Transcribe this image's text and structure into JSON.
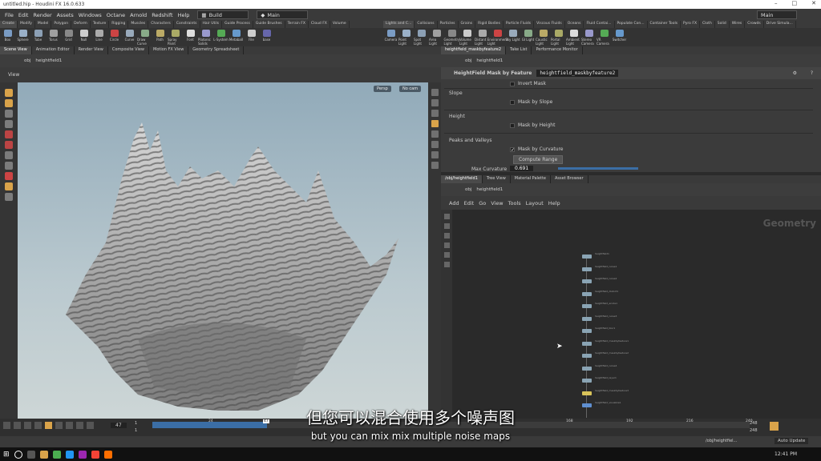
{
  "window": {
    "title": "untitled.hip - Houdini FX 16.0.633"
  },
  "menu": {
    "items": [
      "File",
      "Edit",
      "Render",
      "Assets",
      "Windows",
      "Octane",
      "Arnold",
      "Redshift",
      "Help"
    ],
    "desktop": "Build",
    "context": "Main",
    "right_desktop": "Main"
  },
  "shelf_left_tabs": [
    "Create",
    "Modify",
    "Model",
    "Polygon",
    "Deform",
    "Texture",
    "Rigging",
    "Muscles",
    "Characters",
    "Constraints",
    "Hair Utils",
    "Guide Process",
    "Guide Brushes",
    "Terrain FX",
    "Cloud FX",
    "Volume"
  ],
  "shelf_left_tools": [
    "Box",
    "Sphere",
    "Tube",
    "Torus",
    "Grid",
    "Null",
    "Line",
    "Circle",
    "Curve",
    "Draw Curve",
    "Path",
    "Spray Paint",
    "Font",
    "Platonic Solids",
    "L-System",
    "Metaball",
    "File",
    "base"
  ],
  "shelf_right_tabs": [
    "Lights and C...",
    "Collisions",
    "Particles",
    "Grains",
    "Rigid Bodies",
    "Particle Fluids",
    "Viscous Fluids",
    "Oceans",
    "Fluid Contai...",
    "Populate Con...",
    "Container Tools",
    "Pyro FX",
    "Cloth",
    "Solid",
    "Wires",
    "Crowds",
    "Drive Simula..."
  ],
  "shelf_right_tools": [
    "Camera",
    "Point Light",
    "Spot Light",
    "Area Light",
    "Geometry Light",
    "Volume Light",
    "Distant Light",
    "Environment Light",
    "Sky Light",
    "GI Light",
    "Caustic Light",
    "Portal Light",
    "Ambient Light",
    "Stereo Camera",
    "VR Camera",
    "Switcher"
  ],
  "left_pane": {
    "tabs": [
      "Scene View",
      "Animation Editor",
      "Render View",
      "Composite View",
      "Motion FX View",
      "Geometry Spreadsheet"
    ],
    "path": [
      "obj",
      "heightfield1"
    ],
    "viewport_title": "View",
    "persp_btn": "Persp",
    "cam_btn": "No cam"
  },
  "right_top_pane": {
    "tabs": [
      "heightfield_maskbyfeature2",
      "Take List",
      "Performance Monitor"
    ],
    "path": [
      "obj",
      "heightfield1"
    ],
    "node_type": "HeightField Mask by Feature",
    "node_name": "heightfield_maskbyfeature2",
    "params": {
      "invert_mask": "Invert Mask",
      "slope_section": "Slope",
      "mask_by_slope": "Mask by Slope",
      "height_section": "Height",
      "mask_by_height": "Mask by Height",
      "peaks_section": "Peaks and Valleys",
      "mask_by_curvature": "Mask by Curvature",
      "compute_range": "Compute Range",
      "max_curvature_label": "Max Curvature",
      "max_curvature_value": "0.691"
    }
  },
  "right_bottom_pane": {
    "tabs": [
      "/obj/heightfield1",
      "Tree View",
      "Material Palette",
      "Asset Browser"
    ],
    "path": [
      "obj",
      "heightfield1"
    ],
    "menu": [
      "Add",
      "Edit",
      "Go",
      "View",
      "Tools",
      "Layout",
      "Help"
    ],
    "context_label": "Geometry",
    "nodes": [
      "heightfield1",
      "heightfield_noise1",
      "heightfield_noise2",
      "heightfield_distort1",
      "heightfield_erode1",
      "heightfield_noise3",
      "heightfield_blur1",
      "heightfield_maskbyfeature1",
      "heightfield_maskbyfeature2",
      "heightfield_noise4",
      "heightfield_layer1",
      "heightfield_maskbyfeature3",
      "heightfield_visualize1"
    ]
  },
  "timeline": {
    "frame": "47",
    "start": "1",
    "end_a": "1",
    "ticks": [
      "24",
      "47",
      "168",
      "192",
      "216",
      "240"
    ],
    "range_end_a": "248",
    "range_end_b": "248"
  },
  "status": {
    "path": "/obj/heightfiel...",
    "update_mode": "Auto Update"
  },
  "taskbar": {
    "time": "12:41 PM"
  },
  "subtitles": {
    "zh": "但您可以混合使用多个噪声图",
    "en": "but you can mix mix multiple noise maps"
  }
}
